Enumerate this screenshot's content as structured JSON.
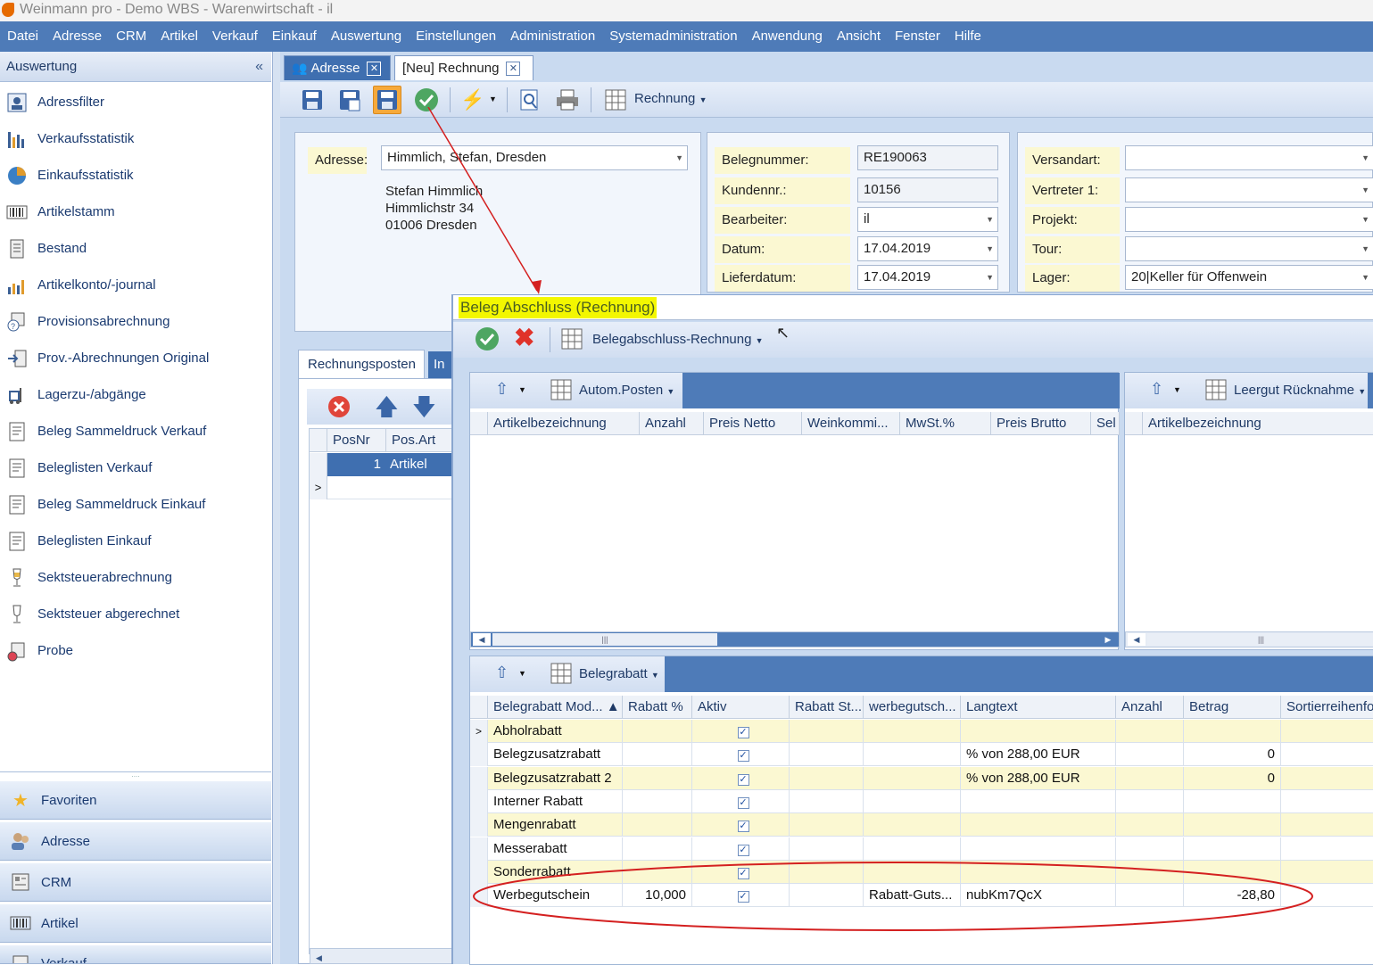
{
  "window": {
    "title": "Weinmann pro - Demo WBS - Warenwirtschaft - il"
  },
  "menu": [
    "Datei",
    "Adresse",
    "CRM",
    "Artikel",
    "Verkauf",
    "Einkauf",
    "Auswertung",
    "Einstellungen",
    "Administration",
    "Systemadministration",
    "Anwendung",
    "Ansicht",
    "Fenster",
    "Hilfe"
  ],
  "sidebar": {
    "header": "Auswertung",
    "collapse": "«",
    "items": [
      {
        "label": "Adressfilter",
        "icon": "person-filter-icon"
      },
      {
        "label": "Verkaufsstatistik",
        "icon": "bar-chart-icon"
      },
      {
        "label": "Einkaufsstatistik",
        "icon": "pie-chart-icon"
      },
      {
        "label": "Artikelstamm",
        "icon": "barcode-icon"
      },
      {
        "label": "Bestand",
        "icon": "document-list-icon"
      },
      {
        "label": "Artikelkonto/-journal",
        "icon": "chart-journal-icon"
      },
      {
        "label": "Provisionsabrechnung",
        "icon": "commission-icon"
      },
      {
        "label": "Prov.-Abrechnungen Original",
        "icon": "import-icon"
      },
      {
        "label": "Lagerzu-/abgänge",
        "icon": "forklift-icon"
      },
      {
        "label": "Beleg Sammeldruck Verkauf",
        "icon": "document-icon"
      },
      {
        "label": "Beleglisten Verkauf",
        "icon": "document-icon"
      },
      {
        "label": "Beleg Sammeldruck Einkauf",
        "icon": "document-icon"
      },
      {
        "label": "Beleglisten Einkauf",
        "icon": "document-icon"
      },
      {
        "label": "Sektsteuerabrechnung",
        "icon": "glass-icon"
      },
      {
        "label": "Sektsteuer abgerechnet",
        "icon": "glass-icon"
      },
      {
        "label": "Probe",
        "icon": "tasting-icon"
      }
    ],
    "nav": [
      {
        "label": "Favoriten",
        "icon": "star-icon"
      },
      {
        "label": "Adresse",
        "icon": "people-icon"
      },
      {
        "label": "CRM",
        "icon": "crm-icon"
      },
      {
        "label": "Artikel",
        "icon": "barcode-icon"
      },
      {
        "label": "Verkauf",
        "icon": "sales-icon"
      }
    ]
  },
  "tabs": [
    {
      "label": "Adresse",
      "close": "✕"
    },
    {
      "label": "[Neu] Rechnung",
      "close": "✕"
    }
  ],
  "toolbar": {
    "rechnung_label": "Rechnung"
  },
  "form": {
    "adresse_label": "Adresse:",
    "adresse_value": "Himmlich, Stefan, Dresden",
    "address_lines": [
      "Stefan Himmlich",
      "Himmlichstr 34",
      "01006 Dresden"
    ],
    "fields_mid": [
      {
        "label": "Belegnummer:",
        "value": "RE190063"
      },
      {
        "label": "Kundennr.:",
        "value": "10156"
      },
      {
        "label": "Bearbeiter:",
        "value": "il"
      },
      {
        "label": "Datum:",
        "value": "17.04.2019"
      },
      {
        "label": "Lieferdatum:",
        "value": "17.04.2019"
      }
    ],
    "fields_right": [
      {
        "label": "Versandart:",
        "value": ""
      },
      {
        "label": "Vertreter 1:",
        "value": ""
      },
      {
        "label": "Projekt:",
        "value": ""
      },
      {
        "label": "Tour:",
        "value": ""
      },
      {
        "label": "Lager:",
        "value": "20|Keller für Offenwein"
      }
    ]
  },
  "posten": {
    "tab_label": "Rechnungsposten",
    "tab2_label": "In",
    "columns": [
      "PosNr",
      "Pos.Art"
    ],
    "rows": [
      {
        "posnr": "1",
        "posart": "Artikel"
      }
    ],
    "new_row_marker": ">"
  },
  "dialog": {
    "title": "Beleg Abschluss (Rechnung)",
    "toolbar_label": "Belegabschluss-Rechnung",
    "auto_posten": {
      "label": "Autom.Posten",
      "columns": [
        "Artikelbezeichnung",
        "Anzahl",
        "Preis Netto",
        "Weinkommi...",
        "MwSt.%",
        "Preis Brutto",
        "Sel"
      ]
    },
    "leergut": {
      "label": "Leergut Rücknahme",
      "columns": [
        "Artikelbezeichnung"
      ]
    },
    "belegrabatt": {
      "label": "Belegrabatt",
      "columns": [
        "Belegrabatt Mod... ▲",
        "Rabatt %",
        "Aktiv",
        "Rabatt St...",
        "werbegutsch...",
        "Langtext",
        "Anzahl",
        "Betrag",
        "Sortierreihenfolge"
      ],
      "rows": [
        {
          "marker": ">",
          "name": "Abholrabatt",
          "rabatt": "",
          "aktiv": "✓",
          "st": "",
          "werbe": "",
          "langtext": "",
          "anzahl": "",
          "betrag": ""
        },
        {
          "marker": "",
          "name": "Belegzusatzrabatt",
          "rabatt": "",
          "aktiv": "✓",
          "st": "",
          "werbe": "",
          "langtext": "% von 288,00 EUR",
          "anzahl": "",
          "betrag": "0"
        },
        {
          "marker": "",
          "name": "Belegzusatzrabatt 2",
          "rabatt": "",
          "aktiv": "✓",
          "st": "",
          "werbe": "",
          "langtext": "% von 288,00 EUR",
          "anzahl": "",
          "betrag": "0"
        },
        {
          "marker": "",
          "name": "Interner Rabatt",
          "rabatt": "",
          "aktiv": "✓",
          "st": "",
          "werbe": "",
          "langtext": "",
          "anzahl": "",
          "betrag": ""
        },
        {
          "marker": "",
          "name": "Mengenrabatt",
          "rabatt": "",
          "aktiv": "✓",
          "st": "",
          "werbe": "",
          "langtext": "",
          "anzahl": "",
          "betrag": ""
        },
        {
          "marker": "",
          "name": "Messerabatt",
          "rabatt": "",
          "aktiv": "✓",
          "st": "",
          "werbe": "",
          "langtext": "",
          "anzahl": "",
          "betrag": ""
        },
        {
          "marker": "",
          "name": "Sonderrabatt",
          "rabatt": "",
          "aktiv": "✓",
          "st": "",
          "werbe": "",
          "langtext": "",
          "anzahl": "",
          "betrag": ""
        },
        {
          "marker": "",
          "name": "Werbegutschein",
          "rabatt": "10,000",
          "aktiv": "✓",
          "st": "",
          "werbe": "Rabatt-Guts...",
          "langtext": "nubKm7QcX",
          "anzahl": "",
          "betrag": "-28,80"
        }
      ]
    }
  },
  "colors": {
    "menu": "#4e7bb8",
    "highlight": "#f3f700",
    "annotation": "#d42020",
    "row_alt": "#fbf8d2"
  }
}
